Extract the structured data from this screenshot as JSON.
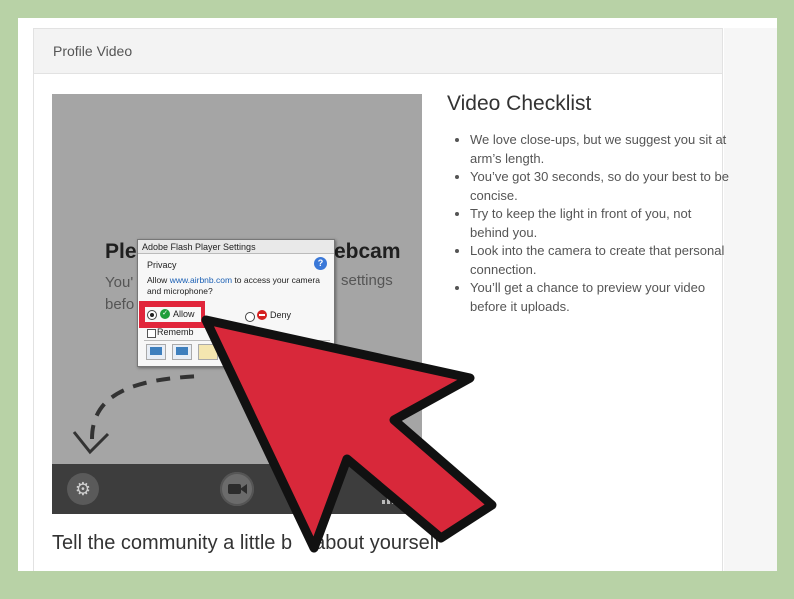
{
  "panel": {
    "title": "Profile Video"
  },
  "webcam": {
    "headline_left": "Ple",
    "headline_right": "ebcam",
    "sub_lines": [
      "You'",
      "befo"
    ],
    "sub_right": "settings"
  },
  "flash_dialog": {
    "title": "Adobe Flash Player Settings",
    "section": "Privacy",
    "message_prefix": "Allow ",
    "message_link": "www.airbnb.com",
    "message_suffix": " to access your camera and microphone?",
    "allow_label": "Allow",
    "deny_label": "Deny",
    "remember_label": "Rememb"
  },
  "checklist": {
    "title": "Video Checklist",
    "items": [
      "We love close-ups, but we suggest you sit at arm’s length.",
      "You’ve got 30 seconds, so do your best to be concise.",
      "Try to keep the light in front of you, not behind you.",
      "Look into the camera to create that personal connection.",
      "You’ll get a chance to preview your video before it uploads."
    ]
  },
  "tagline": {
    "left": "Tell the community a little b",
    "right": "about yourself"
  },
  "icons": {
    "gear": "gear-icon",
    "camera": "video-camera-icon",
    "signal": "signal-bars-icon",
    "help": "help-icon",
    "arrow": "pointer-arrow-icon"
  },
  "colors": {
    "background": "#b8d2a6",
    "arrow": "#d8283a",
    "highlight": "#e1263b"
  }
}
